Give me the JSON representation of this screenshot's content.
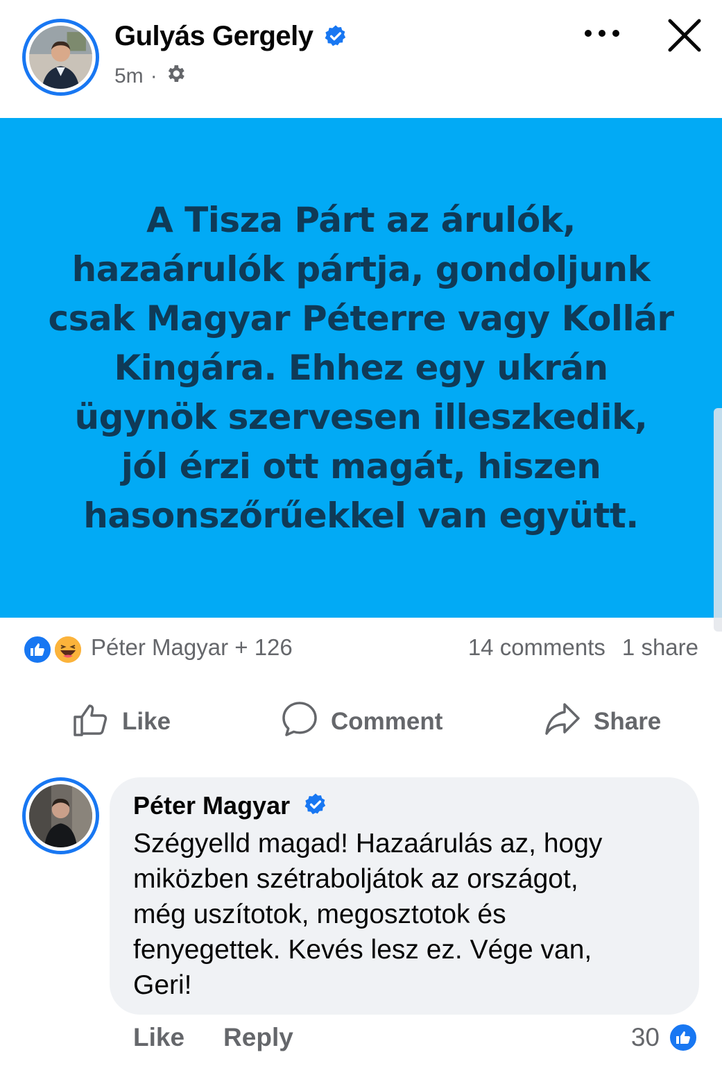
{
  "post": {
    "author": "Gulyás Gergely",
    "time": "5m",
    "separator": "·",
    "text": "A Tisza Párt az árulók,\nhazaárulók pártja, gondoljunk\ncsak Magyar Péterre vagy Kollár\nKingára. Ehhez egy ukrán\nügynök szervesen illeszkedik,\njól  érzi ott magát, hiszen\nhasonszőrűekkel van együtt.",
    "background_color": "#02aaf5",
    "text_color": "#0f3a57"
  },
  "reactions": {
    "names": "Péter Magyar + 126",
    "comments": "14 comments",
    "shares": "1 share",
    "icons": [
      "like-icon",
      "haha-icon"
    ]
  },
  "actions": {
    "like": "Like",
    "comment": "Comment",
    "share": "Share"
  },
  "comment": {
    "author": "Péter Magyar",
    "text": "Szégyelld magad! Hazaárulás az, hogy\nmiközben szétraboljátok az országot,\nmég uszítotok, megosztotok és\nfenyegettek. Kevés lesz ez. Vége van,\nGeri!",
    "like_label": "Like",
    "reply_label": "Reply",
    "reaction_count": "30"
  },
  "colors": {
    "accent": "#1877f2",
    "secondary_text": "#65676b",
    "bubble": "#f0f2f5"
  }
}
